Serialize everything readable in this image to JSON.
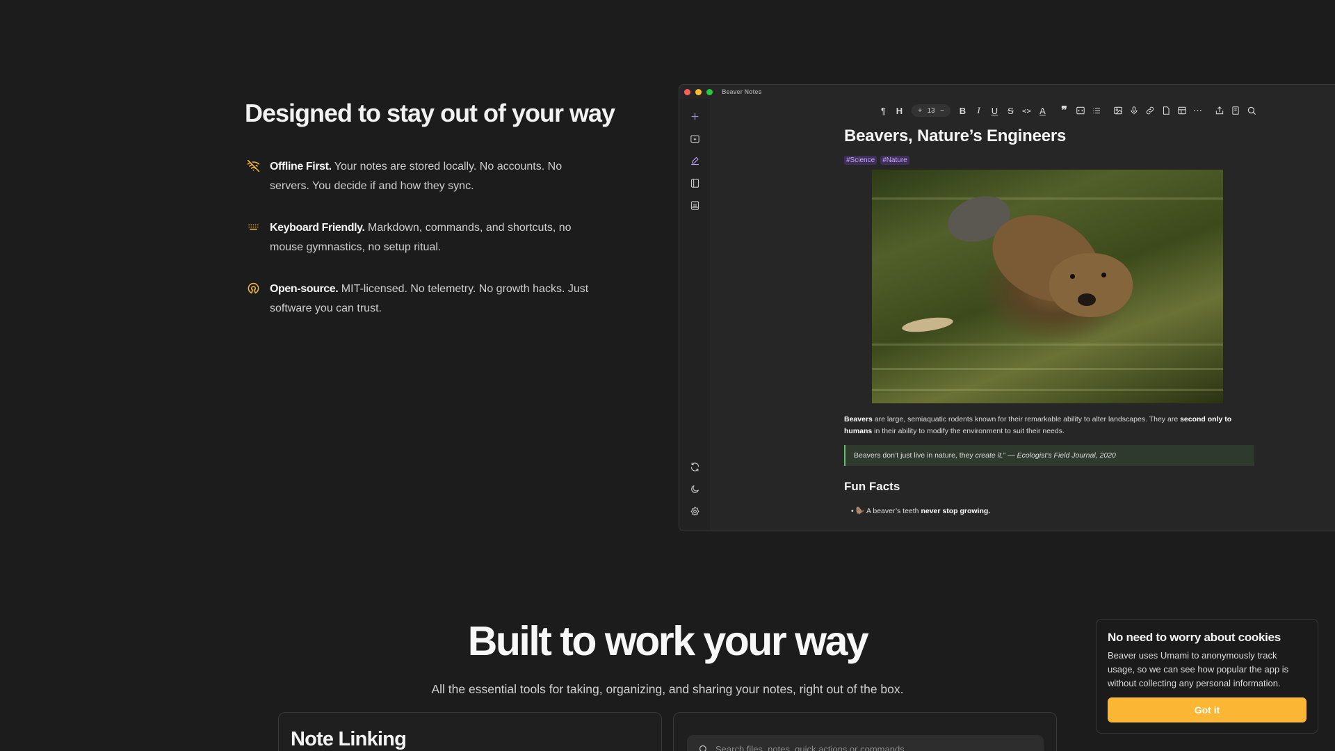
{
  "hero": {
    "title": "Designed to stay out of your way",
    "features": [
      {
        "icon": "wifi-off-icon",
        "bold": "Offline First.",
        "text": " Your notes are stored locally. No accounts. No servers. You decide if and how they sync."
      },
      {
        "icon": "keyboard-icon",
        "bold": "Keyboard Friendly.",
        "text": " Markdown, commands, and shortcuts, no mouse gymnastics, no setup ritual."
      },
      {
        "icon": "open-source-icon",
        "bold": "Open-source.",
        "text": " MIT-licensed. No telemetry. No growth hacks. Just software you can trust."
      }
    ],
    "accent_color": "#f2b53c"
  },
  "app": {
    "window_title": "Beaver Notes",
    "font_size": "13",
    "note": {
      "title": "Beavers, Nature’s Engineers",
      "tags": [
        "#Science",
        "#Nature"
      ],
      "paragraph": {
        "b1": "Beavers",
        "t1": " are large, semiaquatic rodents known for their remarkable ability to alter landscapes. They are ",
        "b2": "second only to humans",
        "t2": " in their ability to modify the environment to suit their needs."
      },
      "quote": {
        "t1": "Beavers don’t just live in nature, they ",
        "em": "create it.",
        "t2": "” — ",
        "source": "Ecologist’s Field Journal, 2020"
      },
      "heading": "Fun Facts",
      "bullet": {
        "emoji": "🦫",
        "t1": " A beaver’s teeth ",
        "b": "never stop growing."
      }
    },
    "tag_color": "#c9a9ff",
    "quote_border_color": "#5fbf6b"
  },
  "section2": {
    "title": "Built to work your way",
    "subtitle": "All the essential tools for taking, organizing, and sharing your notes, right out of the box.",
    "card_left_title": "Note Linking",
    "search_placeholder": "Search files, notes, quick actions or commands..."
  },
  "cookie": {
    "title": "No need to worry about cookies",
    "text": "Beaver uses Umami to anonymously track usage, so we can see how popular the app is without collecting any personal information.",
    "button": "Got it",
    "button_color": "#fbb633"
  }
}
